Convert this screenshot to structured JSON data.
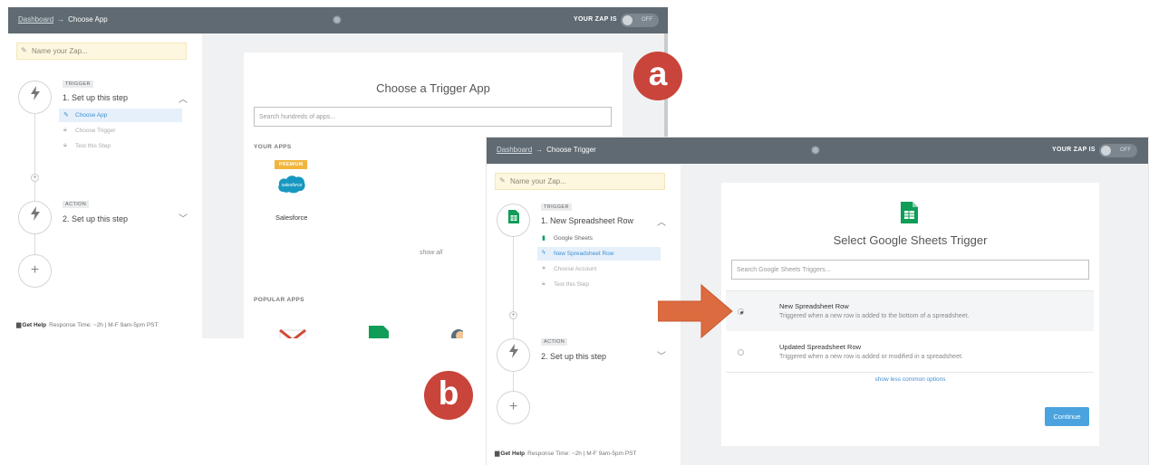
{
  "colors": {
    "topbar": "#5f6a72",
    "badge": "#c9443a",
    "arrow": "#dc6b3f",
    "accent_blue": "#4aa3df",
    "premium": "#f2b53c",
    "sheets_green": "#0f9d58"
  },
  "screenshot_a": {
    "badge": "a",
    "breadcrumb": {
      "link": "Dashboard",
      "arrow": "→",
      "current": "Choose App"
    },
    "zap_state": {
      "label": "YOUR ZAP IS",
      "toggle": "OFF"
    },
    "zap_name_placeholder": "Name your Zap...",
    "trigger_step": {
      "tag": "TRIGGER",
      "title": "1. Set up this step",
      "icon": "lightning-icon",
      "substeps": [
        {
          "label": "Choose App",
          "icon": "pencil-icon"
        },
        {
          "label": "Choose Trigger",
          "icon": "lock-icon"
        },
        {
          "label": "Test this Step",
          "icon": "lock-icon"
        }
      ]
    },
    "action_step": {
      "tag": "ACTION",
      "title": "2. Set up this step",
      "icon": "lightning-icon"
    },
    "add_step": "+",
    "help": {
      "label": "Get Help",
      "text": "Response Time: ~2h | M-F 9am-5pm PST"
    },
    "main": {
      "title": "Choose a Trigger App",
      "search_placeholder": "Search hundreds of apps...",
      "your_apps_label": "YOUR APPS",
      "premium_badge": "PREMIUM",
      "app_logo_text": "salesforce",
      "app_name": "Salesforce",
      "show_all": "show all",
      "popular_apps_label": "POPULAR APPS",
      "popular_apps": [
        "gmail-icon",
        "google-sheets-icon",
        "mailchimp-icon"
      ]
    }
  },
  "screenshot_b": {
    "badge": "b",
    "breadcrumb": {
      "link": "Dashboard",
      "arrow": "→",
      "current": "Choose Trigger"
    },
    "zap_state": {
      "label": "YOUR ZAP IS",
      "toggle": "OFF"
    },
    "zap_name_placeholder": "Name your Zap...",
    "trigger_step": {
      "tag": "TRIGGER",
      "title": "1. New Spreadsheet Row",
      "icon": "google-sheets-icon",
      "substeps": [
        {
          "label": "Google Sheets",
          "icon": "google-sheets-icon"
        },
        {
          "label": "New Spreadsheet Row",
          "icon": "lightning-icon"
        },
        {
          "label": "Choose Account",
          "icon": "user-icon"
        },
        {
          "label": "Test this Step",
          "icon": "lock-icon"
        }
      ]
    },
    "action_step": {
      "tag": "ACTION",
      "title": "2. Set up this step",
      "icon": "lightning-icon"
    },
    "add_step": "+",
    "help": {
      "label": "Get Help",
      "text": "Response Time: ~2h | M-F 9am-5pm PST"
    },
    "main": {
      "title": "Select Google Sheets Trigger",
      "search_placeholder": "Search Google Sheets Triggers...",
      "options": [
        {
          "name": "New Spreadsheet Row",
          "desc": "Triggered when a new row is added to the bottom of a spreadsheet.",
          "selected": true
        },
        {
          "name": "Updated Spreadsheet Row",
          "desc": "Triggered when a new row is added or modified in a spreadsheet.",
          "selected": false
        }
      ],
      "less_link": "show less common options",
      "continue_label": "Continue"
    }
  }
}
